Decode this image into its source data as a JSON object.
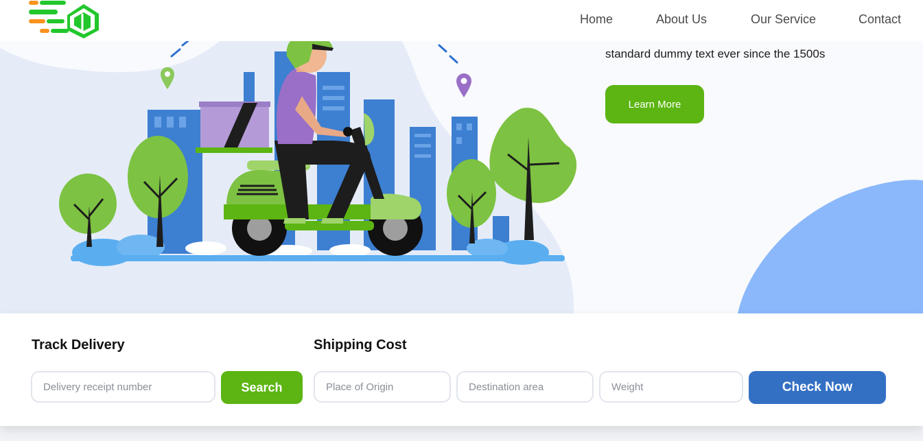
{
  "nav": {
    "links": [
      "Home",
      "About Us",
      "Our Service",
      "Contact"
    ]
  },
  "hero": {
    "text": "standard dummy text ever since the 1500s",
    "cta_label": "Learn More"
  },
  "track": {
    "title": "Track Delivery",
    "input_placeholder": "Delivery receipt number",
    "button_label": "Search"
  },
  "shipping": {
    "title": "Shipping Cost",
    "origin_placeholder": "Place of Origin",
    "destination_placeholder": "Destination area",
    "weight_placeholder": "Weight",
    "button_label": "Check Now"
  },
  "colors": {
    "brand_green": "#5cb512",
    "brand_blue": "#3370c4",
    "logo_green": "#22c72c",
    "logo_orange": "#f7931e"
  }
}
